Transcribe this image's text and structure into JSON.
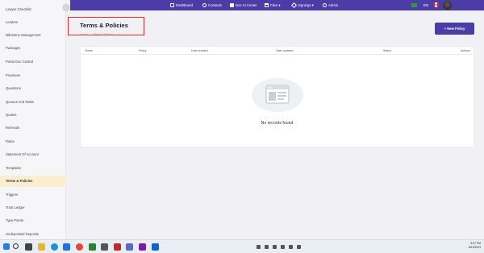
{
  "sidebar": {
    "items": [
      {
        "label": "Lawyer Checklist",
        "active": false
      },
      {
        "label": "Lenders",
        "active": false
      },
      {
        "label": "Milestone Management",
        "active": false
      },
      {
        "label": "Packages",
        "active": false
      },
      {
        "label": "Portal Doc Control",
        "active": false
      },
      {
        "label": "Provinces",
        "active": false
      },
      {
        "label": "Questions",
        "active": false
      },
      {
        "label": "Queues And Tasks",
        "active": false
      },
      {
        "label": "Quotes",
        "active": false
      },
      {
        "label": "Referrals",
        "active": false
      },
      {
        "label": "Roles",
        "active": false
      },
      {
        "label": "Statement Of Account",
        "active": false
      },
      {
        "label": "Templates",
        "active": false
      },
      {
        "label": "Terms & Policies",
        "active": true
      },
      {
        "label": "Triggers",
        "active": false
      },
      {
        "label": "Trust Ledger",
        "active": false
      },
      {
        "label": "Type Points",
        "active": false
      },
      {
        "label": "Undeposited Deposits",
        "active": false
      }
    ]
  },
  "topnav": {
    "items": [
      {
        "label": "Dashboard",
        "icon": "dashboard-icon"
      },
      {
        "label": "Contacts",
        "icon": "contacts-icon"
      },
      {
        "label": "Doc AI Center",
        "icon": "document-icon"
      },
      {
        "label": "Files ▾",
        "icon": "folder-icon"
      },
      {
        "label": "Signings ▾",
        "icon": "signing-icon"
      },
      {
        "label": "Admin",
        "icon": "admin-icon"
      }
    ],
    "language": "EN"
  },
  "page": {
    "title": "Terms & Policies",
    "breadcrumb": [
      "Admin",
      "Terms & Policies"
    ],
    "new_button": "+ New Policy"
  },
  "table": {
    "columns": [
      "Terms",
      "Policy",
      "Date created",
      "Date updated",
      "Status",
      "Actions"
    ],
    "rows": [],
    "empty_text": "No records found"
  },
  "taskbar": {
    "time": "5:47 PM",
    "date": "6/13/2023"
  },
  "colors": {
    "brand": "#4c3ca8",
    "active_item": "#fbeed0",
    "highlight_box": "#e03030"
  }
}
